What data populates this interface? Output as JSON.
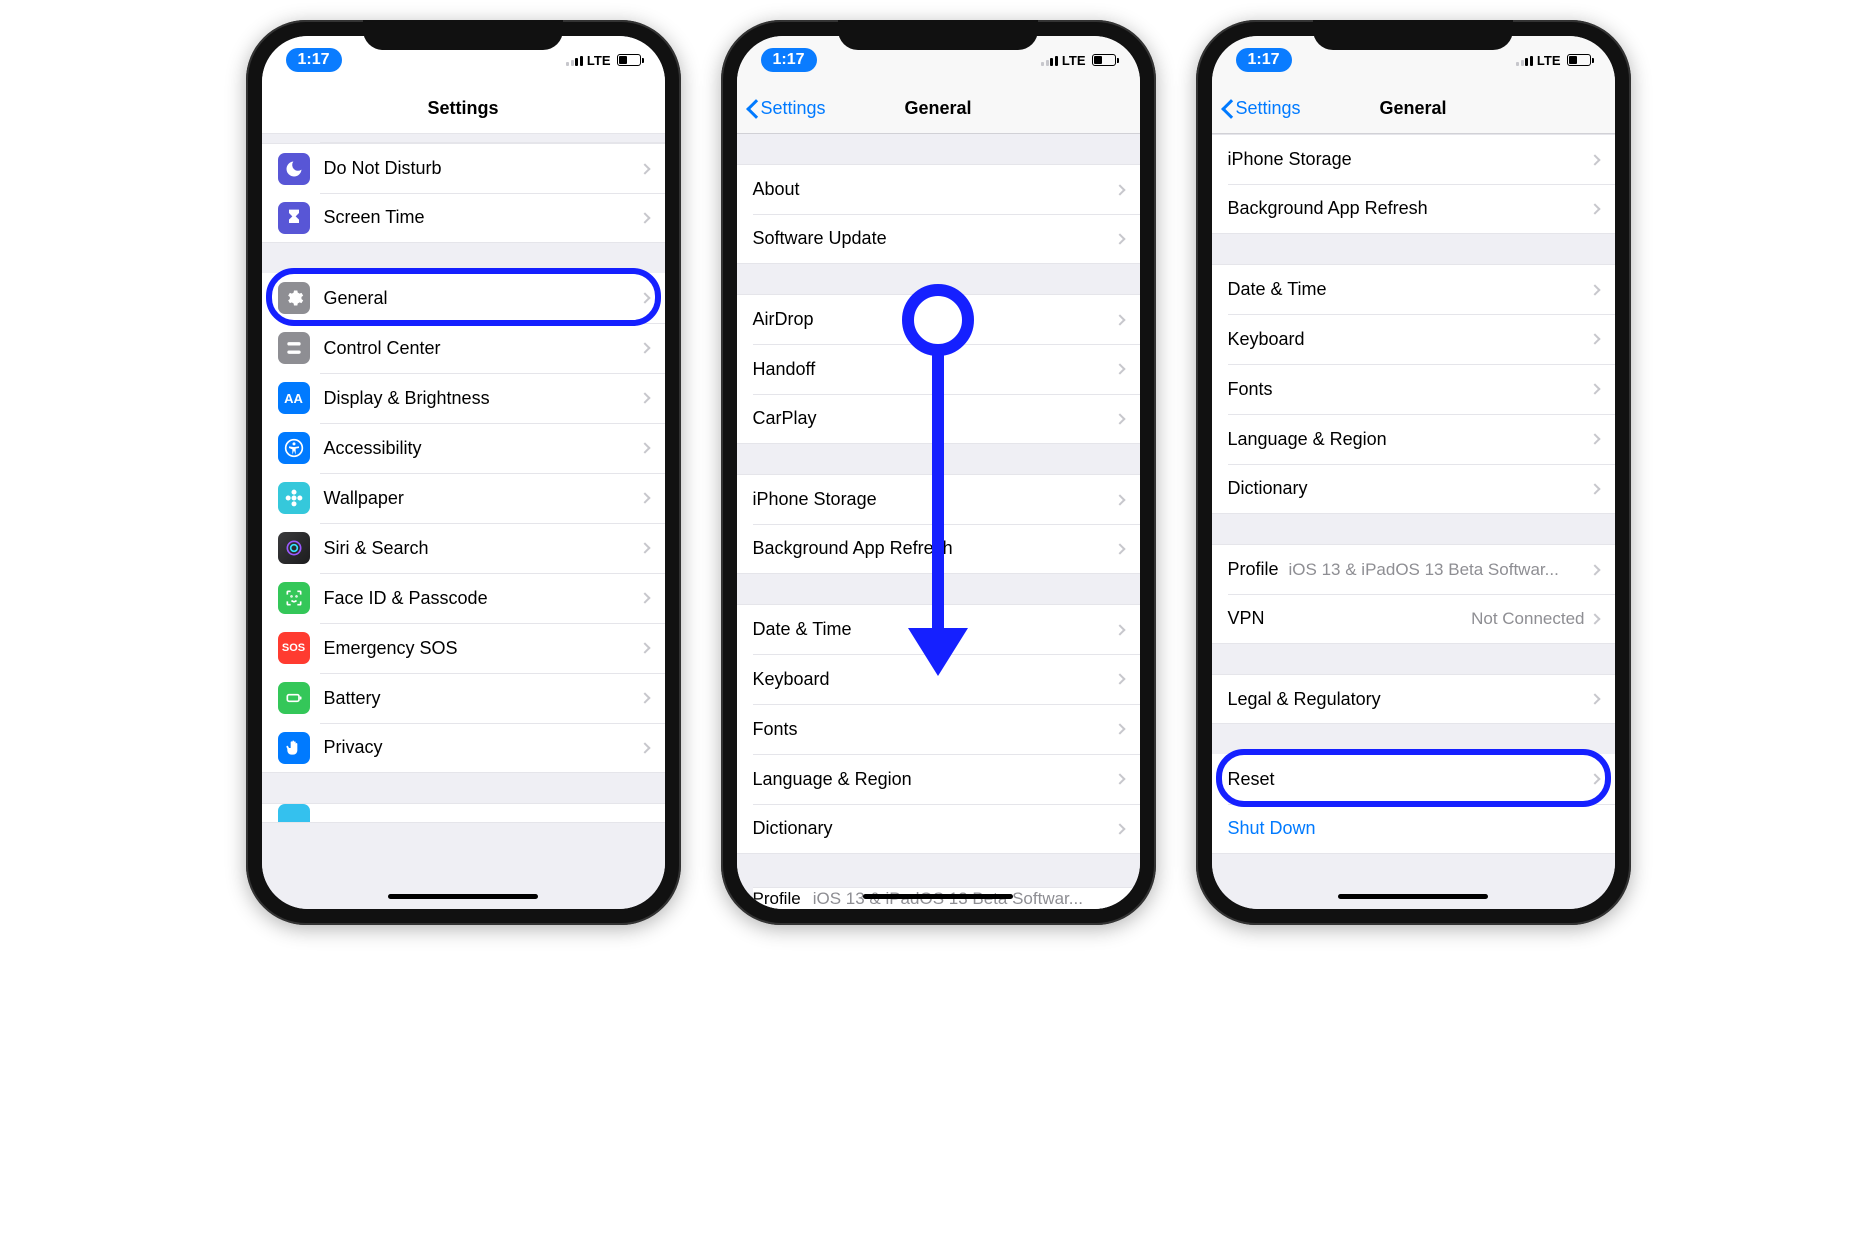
{
  "status": {
    "time": "1:17",
    "carrier": "LTE"
  },
  "screen1": {
    "title": "Settings",
    "group1": [
      {
        "label": "Do Not Disturb"
      },
      {
        "label": "Screen Time"
      }
    ],
    "group2": [
      {
        "label": "General"
      },
      {
        "label": "Control Center"
      },
      {
        "label": "Display & Brightness"
      },
      {
        "label": "Accessibility"
      },
      {
        "label": "Wallpaper"
      },
      {
        "label": "Siri & Search"
      },
      {
        "label": "Face ID & Passcode"
      },
      {
        "label": "Emergency SOS"
      },
      {
        "label": "Battery"
      },
      {
        "label": "Privacy"
      }
    ]
  },
  "screen2": {
    "back": "Settings",
    "title": "General",
    "group1": [
      {
        "label": "About"
      },
      {
        "label": "Software Update"
      }
    ],
    "group2": [
      {
        "label": "AirDrop"
      },
      {
        "label": "Handoff"
      },
      {
        "label": "CarPlay"
      }
    ],
    "group3": [
      {
        "label": "iPhone Storage"
      },
      {
        "label": "Background App Refresh"
      }
    ],
    "group4": [
      {
        "label": "Date & Time"
      },
      {
        "label": "Keyboard"
      },
      {
        "label": "Fonts"
      },
      {
        "label": "Language & Region"
      },
      {
        "label": "Dictionary"
      }
    ],
    "cutoff": {
      "label": "Profile",
      "detail": "iOS 13 & iPadOS 13 Beta Softwar..."
    }
  },
  "screen3": {
    "back": "Settings",
    "title": "General",
    "group0": [
      {
        "label": "iPhone Storage"
      },
      {
        "label": "Background App Refresh"
      }
    ],
    "group1": [
      {
        "label": "Date & Time"
      },
      {
        "label": "Keyboard"
      },
      {
        "label": "Fonts"
      },
      {
        "label": "Language & Region"
      },
      {
        "label": "Dictionary"
      }
    ],
    "group2": [
      {
        "label": "Profile",
        "detail": "iOS 13 & iPadOS 13 Beta Softwar..."
      },
      {
        "label": "VPN",
        "detail": "Not Connected"
      }
    ],
    "group3": [
      {
        "label": "Legal & Regulatory"
      }
    ],
    "group4": [
      {
        "label": "Reset"
      },
      {
        "label": "Shut Down"
      }
    ]
  }
}
